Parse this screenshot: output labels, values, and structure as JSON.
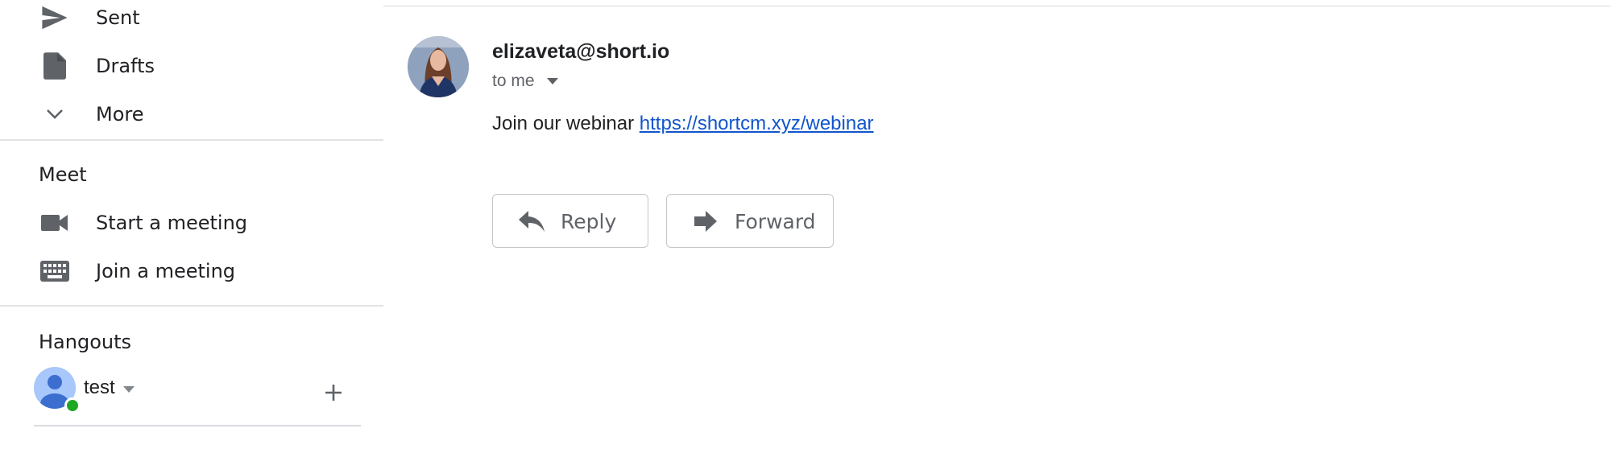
{
  "sidebar": {
    "items": [
      {
        "label": "Sent",
        "icon": "send-icon"
      },
      {
        "label": "Drafts",
        "icon": "draft-icon"
      },
      {
        "label": "More",
        "icon": "chevron-down-icon"
      }
    ],
    "meet": {
      "heading": "Meet",
      "items": [
        {
          "label": "Start a meeting",
          "icon": "video-camera-icon"
        },
        {
          "label": "Join a meeting",
          "icon": "keyboard-icon"
        }
      ]
    },
    "hangouts": {
      "heading": "Hangouts",
      "user": {
        "name": "test",
        "status": "online",
        "status_color": "#1fa824"
      },
      "add_icon": "plus-icon"
    }
  },
  "message": {
    "sender": "elizaveta@short.io",
    "recipient": "to me",
    "body_text": "Join our webinar",
    "link": "https://shortcm.xyz/webinar",
    "link_color": "#1155cc",
    "actions": {
      "reply": "Reply",
      "forward": "Forward"
    }
  }
}
